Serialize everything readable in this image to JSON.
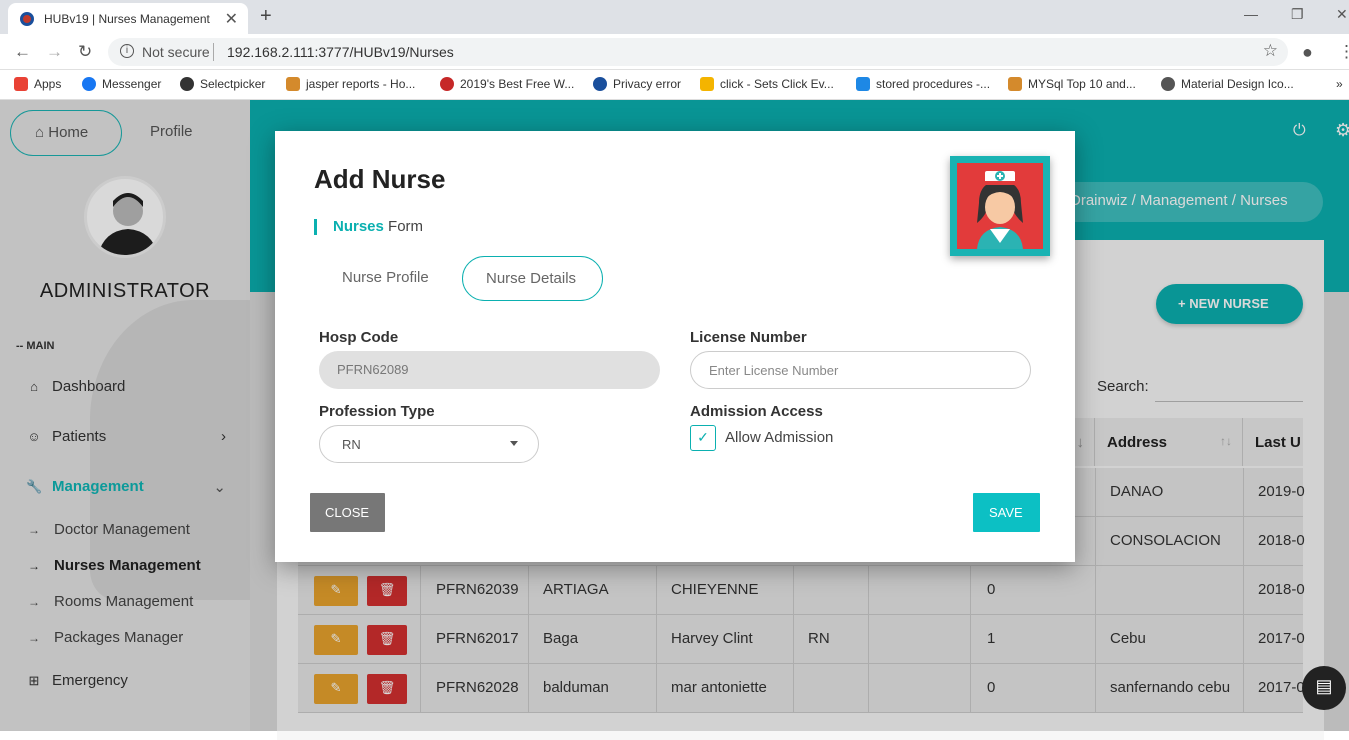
{
  "browser": {
    "tab_title": "HUBv19 | Nurses Management",
    "new_tab": "+",
    "not_secure": "Not secure",
    "url": "192.168.2.111:3777/HUBv19/Nurses",
    "bookmarks": [
      {
        "label": "Apps",
        "color": "#e94235"
      },
      {
        "label": "Messenger",
        "color": "#1877f2"
      },
      {
        "label": "Selectpicker",
        "color": "#333333"
      },
      {
        "label": "jasper reports - Ho...",
        "color": "#d48a2c"
      },
      {
        "label": "2019's Best Free W...",
        "color": "#c62828"
      },
      {
        "label": "Privacy error",
        "color": "#1a4f9c"
      },
      {
        "label": "click - Sets Click Ev...",
        "color": "#f4b400"
      },
      {
        "label": "stored procedures -...",
        "color": "#1e88e5"
      },
      {
        "label": "MYSql Top 10 and...",
        "color": "#d48a2c"
      },
      {
        "label": "Material Design Ico...",
        "color": "#555555"
      }
    ]
  },
  "sidebar": {
    "home": "Home",
    "profile": "Profile",
    "user_name": "ADMINISTRATOR",
    "section_label": "-- MAIN",
    "items": [
      {
        "label": "Dashboard",
        "icon": "home-icon"
      },
      {
        "label": "Patients",
        "icon": "face-icon"
      },
      {
        "label": "Management",
        "icon": "wrench-icon"
      }
    ],
    "sub_items": [
      "Doctor Management",
      "Nurses Management",
      "Rooms Management",
      "Packages Manager"
    ],
    "emergency": "Emergency"
  },
  "header": {
    "breadcrumb": "Drainwiz / Management / Nurses"
  },
  "page": {
    "new_nurse": "NEW NURSE",
    "search_label": "Search:",
    "columns": {
      "address": "Address",
      "last_updated": "Last U"
    },
    "rows": [
      {
        "address": "DANAO",
        "last": "2019-0"
      },
      {
        "address": "CONSOLACION",
        "last": "2018-0"
      },
      {
        "code": "PFRN62039",
        "last_name": "ARTIAGA",
        "first_name": "CHIEYENNE",
        "prof": "",
        "count": "0",
        "address": "",
        "last": "2018-0"
      },
      {
        "code": "PFRN62017",
        "last_name": "Baga",
        "first_name": "Harvey Clint",
        "prof": "RN",
        "count": "1",
        "address": "Cebu",
        "last": "2017-0"
      },
      {
        "code": "PFRN62028",
        "last_name": "balduman",
        "first_name": "mar antoniette",
        "prof": "",
        "count": "0",
        "address": "sanfernando cebu",
        "last": "2017-0"
      }
    ]
  },
  "modal": {
    "title": "Add Nurse",
    "subtitle_strong": "Nurses",
    "subtitle_rest": " Form",
    "tab_profile": "Nurse Profile",
    "tab_details": "Nurse Details",
    "hosp_code_label": "Hosp Code",
    "hosp_code_value": "PFRN62089",
    "license_label": "License Number",
    "license_placeholder": "Enter License Number",
    "profession_label": "Profession Type",
    "profession_value": "RN",
    "admission_label": "Admission Access",
    "allow_admission": "Allow Admission",
    "allow_admission_checked": true,
    "close": "CLOSE",
    "save": "SAVE"
  },
  "colors": {
    "accent": "#0bb0b0",
    "edit": "#e8a32d",
    "delete": "#d32f2f"
  }
}
